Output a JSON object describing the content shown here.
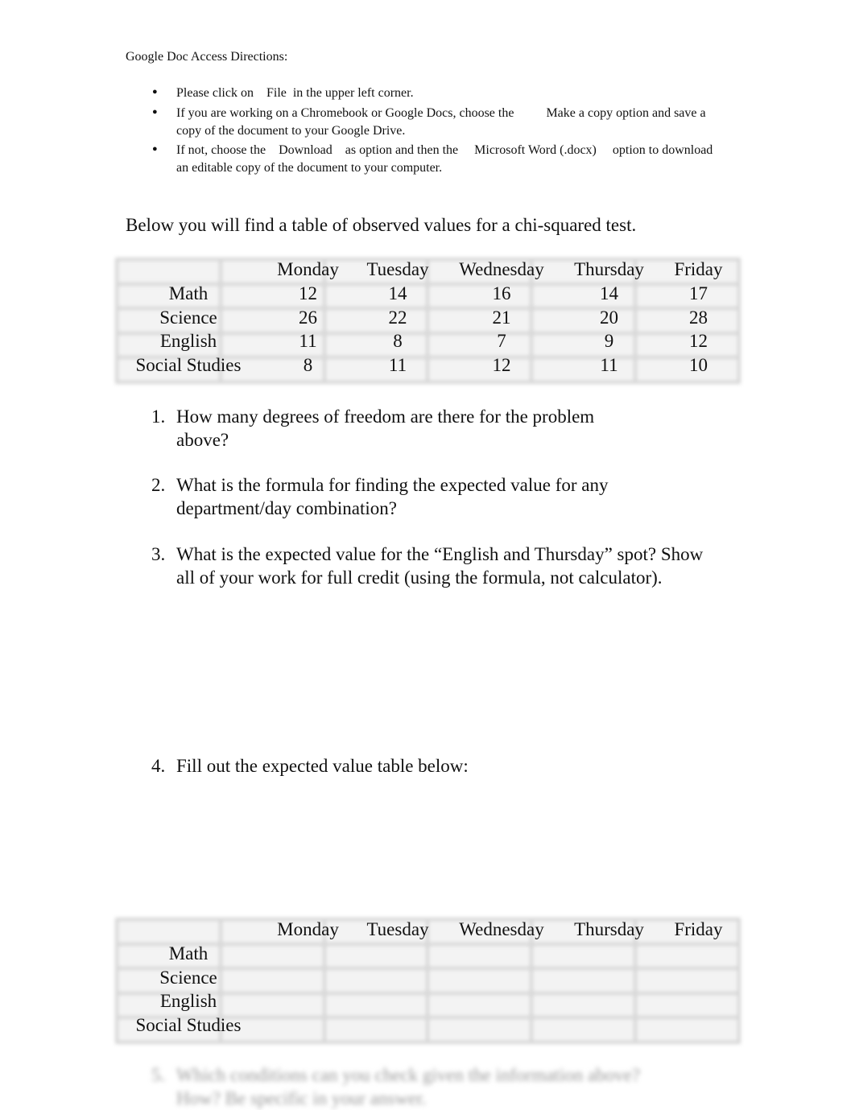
{
  "directions": {
    "title": "Google Doc Access Directions:",
    "bullets": [
      "Please click on    File  in the upper left corner.",
      "If you are working on a Chromebook or Google Docs, choose the          Make a copy option and save a copy of the document to your Google Drive.",
      "If not, choose the    Download    as option and then the     Microsoft Word (.docx)     option to download an editable copy of the document to your computer."
    ]
  },
  "intro": "Below you will find a table of observed values for a chi-squared test.",
  "observed_table": {
    "headers": [
      "",
      "Monday",
      "Tuesday",
      "Wednesday",
      "Thursday",
      "Friday"
    ],
    "rows": [
      [
        "Math",
        "12",
        "14",
        "16",
        "14",
        "17"
      ],
      [
        "Science",
        "26",
        "22",
        "21",
        "20",
        "28"
      ],
      [
        "English",
        "11",
        "8",
        "7",
        "9",
        "12"
      ],
      [
        "Social Studies",
        "8",
        "11",
        "12",
        "11",
        "10"
      ]
    ]
  },
  "questions": [
    {
      "num": "1.",
      "text": "How many degrees of freedom are there for the problem above?"
    },
    {
      "num": "2.",
      "text": "What is the formula for finding the expected value for any department/day combination?"
    },
    {
      "num": "3.",
      "text": "What is the expected value for the “English and Thursday” spot? Show all of your work for full credit (using the formula, not calculator)."
    },
    {
      "num": "4.",
      "text": "Fill out the expected value table below:"
    },
    {
      "num": "5.",
      "text": "Which conditions can you check given the information above? How? Be specific in your answer."
    }
  ],
  "expected_table": {
    "headers": [
      "",
      "Monday",
      "Tuesday",
      "Wednesday",
      "Thursday",
      "Friday"
    ],
    "rows": [
      [
        "Math",
        "",
        "",
        "",
        "",
        ""
      ],
      [
        "Science",
        "",
        "",
        "",
        "",
        ""
      ],
      [
        "English",
        "",
        "",
        "",
        "",
        ""
      ],
      [
        "Social Studies",
        "",
        "",
        "",
        "",
        ""
      ]
    ]
  }
}
